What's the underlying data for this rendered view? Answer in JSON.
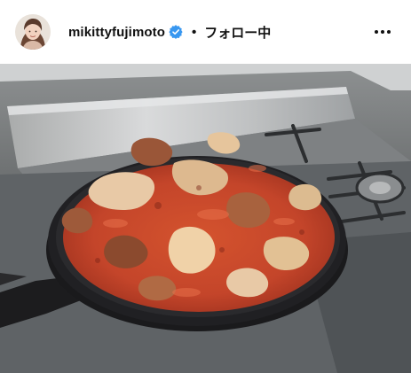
{
  "post": {
    "username": "mikittyfujimoto",
    "separator": "•",
    "follow_status": "フォロー中"
  },
  "icons": {
    "avatar": "profile-avatar",
    "verified": "verified-badge-icon",
    "more": "more-options-icon"
  },
  "colors": {
    "verified_badge": "#3897f0",
    "text": "#111111",
    "stew": "#c8432a",
    "pan": "#1c1c1e"
  }
}
